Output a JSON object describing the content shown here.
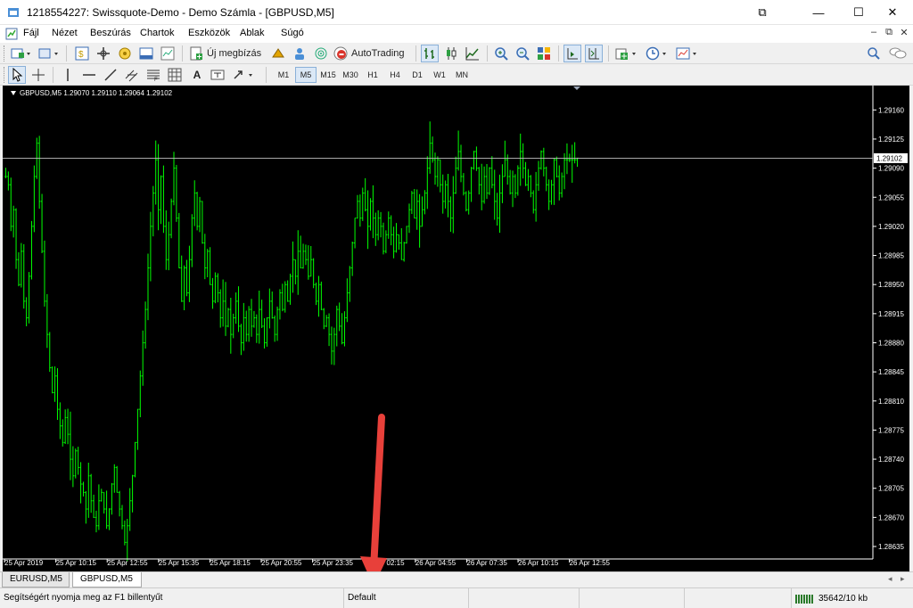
{
  "window": {
    "title": "1218554227: Swissquote-Demo - Demo Számla - [GBPUSD,M5]"
  },
  "menu": {
    "items": [
      "Fájl",
      "Nézet",
      "Beszúrás",
      "Chartok",
      "Eszközök",
      "Ablak",
      "Súgó"
    ]
  },
  "toolbar": {
    "new_order_label": "Új megbízás",
    "autotrading_label": "AutoTrading",
    "timeframes": [
      "M1",
      "M5",
      "M15",
      "M30",
      "H1",
      "H4",
      "D1",
      "W1",
      "MN"
    ],
    "active_timeframe": "M5",
    "text_tool_label": "A"
  },
  "chart": {
    "symbol_info": "GBPUSD,M5  1.29070 1.29110 1.29064 1.29102",
    "current_price_label": "1.29102",
    "background": "#000000",
    "bar_color": "#00ff00",
    "crosshair_line_color": "#c0c0c0"
  },
  "chart_data": {
    "type": "bar",
    "symbol": "GBPUSD",
    "timeframe": "M5",
    "y_ticks": [
      "1.29160",
      "1.29125",
      "1.29090",
      "1.29055",
      "1.29020",
      "1.28985",
      "1.28950",
      "1.28915",
      "1.28880",
      "1.28845",
      "1.28810",
      "1.28775",
      "1.28740",
      "1.28705",
      "1.28670",
      "1.28635"
    ],
    "ylim": [
      1.2862,
      1.29185
    ],
    "current_price": 1.29102,
    "x_ticks": [
      "25 Apr 2019",
      "25 Apr 10:15",
      "25 Apr 12:55",
      "25 Apr 15:35",
      "25 Apr 18:15",
      "25 Apr 20:55",
      "25 Apr 23:35",
      "26 Apr 02:15",
      "26 Apr 04:55",
      "26 Apr 07:35",
      "26 Apr 10:15",
      "26 Apr 12:55"
    ],
    "bar_count": 220,
    "series": [
      {
        "close": [
          1.2908,
          1.2907,
          1.2902,
          1.2904,
          1.2898,
          1.2895,
          1.2899,
          1.2893,
          1.2891,
          1.2896,
          1.2902,
          1.2908,
          1.2912,
          1.2905,
          1.2899,
          1.2893,
          1.2889,
          1.2885,
          1.2882,
          1.2884,
          1.288,
          1.2878,
          1.2876,
          1.2879,
          1.2877,
          1.2874,
          1.2872,
          1.2875,
          1.2873,
          1.2871,
          1.287,
          1.2868,
          1.2872,
          1.2869,
          1.2867,
          1.2866,
          1.2869,
          1.287,
          1.2868,
          1.2866,
          1.2868,
          1.2871,
          1.2873,
          1.287,
          1.2868,
          1.2866,
          1.2864,
          1.2866,
          1.2869,
          1.2872,
          1.2876,
          1.288,
          1.2884,
          1.2888,
          1.2892,
          1.2897,
          1.2902,
          1.2906,
          1.291,
          1.2904,
          1.2908,
          1.2902,
          1.2898,
          1.2901,
          1.2905,
          1.2909,
          1.2903,
          1.2897,
          1.2893,
          1.2897,
          1.2894,
          1.2898,
          1.2903,
          1.2906,
          1.2902,
          1.2905,
          1.29,
          1.2897,
          1.2899,
          1.2895,
          1.2893,
          1.2896,
          1.2894,
          1.2891,
          1.2893,
          1.289,
          1.2892,
          1.2889,
          1.2891,
          1.2893,
          1.289,
          1.2888,
          1.2891,
          1.2889,
          1.2892,
          1.289,
          1.2891,
          1.2889,
          1.2892,
          1.289,
          1.2888,
          1.2891,
          1.2893,
          1.2891,
          1.2889,
          1.2892,
          1.2894,
          1.2892,
          1.2895,
          1.2893,
          1.2896,
          1.2898,
          1.2896,
          1.2899,
          1.2897,
          1.2899,
          1.2898,
          1.2896,
          1.2898,
          1.2895,
          1.2893,
          1.2895,
          1.2892,
          1.289,
          1.2891,
          1.2889,
          1.2887,
          1.2889,
          1.2892,
          1.289,
          1.2888,
          1.2891,
          1.2894,
          1.2897,
          1.29,
          1.2903,
          1.2905,
          1.2903,
          1.2906,
          1.2904,
          1.2902,
          1.2905,
          1.2903,
          1.2901,
          1.2903,
          1.2902,
          1.2899,
          1.2901,
          1.2903,
          1.2901,
          1.2899,
          1.2901,
          1.29,
          1.2898,
          1.29,
          1.2902,
          1.2904,
          1.2906,
          1.2903,
          1.2905,
          1.2902,
          1.2904,
          1.2906,
          1.2909,
          1.2912,
          1.291,
          1.2908,
          1.291,
          1.2907,
          1.2905,
          1.2907,
          1.2905,
          1.2903,
          1.2906,
          1.2909,
          1.2911,
          1.2908,
          1.2906,
          1.2904,
          1.2906,
          1.2909,
          1.2911,
          1.2909,
          1.2907,
          1.2905,
          1.2908,
          1.2906,
          1.2909,
          1.2907,
          1.2905,
          1.2903,
          1.2906,
          1.2908,
          1.291,
          1.2908,
          1.2906,
          1.2908,
          1.2906,
          1.2909,
          1.2911,
          1.2909,
          1.2907,
          1.2908,
          1.2906,
          1.2904,
          1.2907,
          1.2909,
          1.2911,
          1.2909,
          1.2907,
          1.2905,
          1.2907,
          1.291,
          1.2908,
          1.2906,
          1.2908,
          1.291,
          1.291,
          1.291,
          1.291,
          1.291,
          1.29102
        ]
      }
    ]
  },
  "tabs": {
    "items": [
      "EURUSD,M5",
      "GBPUSD,M5"
    ],
    "active": "GBPUSD,M5"
  },
  "status": {
    "help_text": "Segítségért nyomja meg az F1 billentyűt",
    "profile": "Default",
    "connection": "35642/10 kb"
  },
  "annotation": {
    "arrow_color": "#e8403a"
  }
}
